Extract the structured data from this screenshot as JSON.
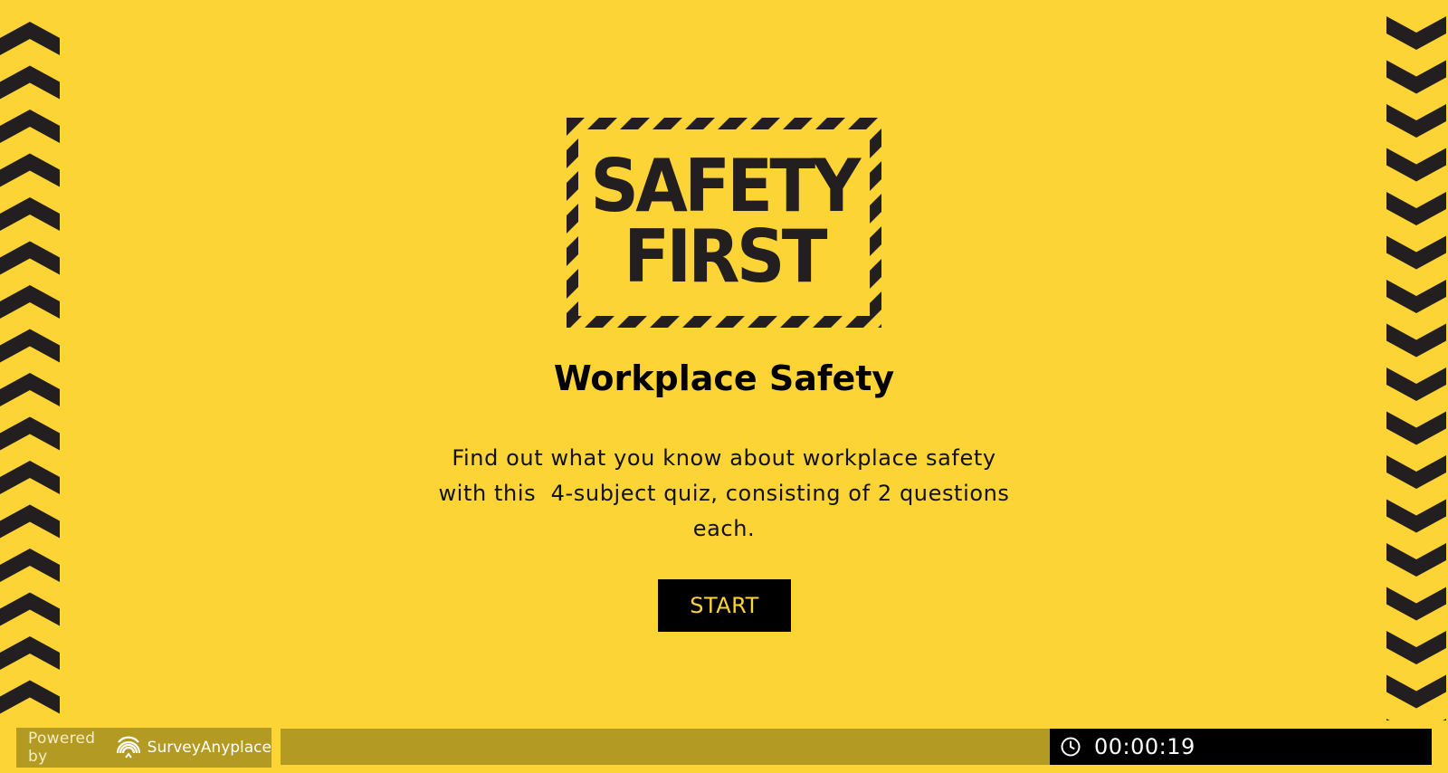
{
  "logo": {
    "line1": "SAFETY",
    "line2": "FIRST"
  },
  "quiz": {
    "title": "Workplace Safety",
    "description": "Find out what you know about workplace safety with this  4-subject quiz, consisting of 2 questions each.",
    "start_label": "START"
  },
  "footer": {
    "powered_by": "Powered by",
    "brand_name": "SurveyAnyplace",
    "progress": 0,
    "timer": "00:00:19"
  },
  "icons": {
    "brand": "surveyanyplace-logo-icon",
    "timer": "clock-icon"
  },
  "colors": {
    "background": "#fdd435",
    "stripe": "#231f20",
    "button": "#000000",
    "button_text": "#fdd435",
    "footer_bar": "#b29a23"
  }
}
